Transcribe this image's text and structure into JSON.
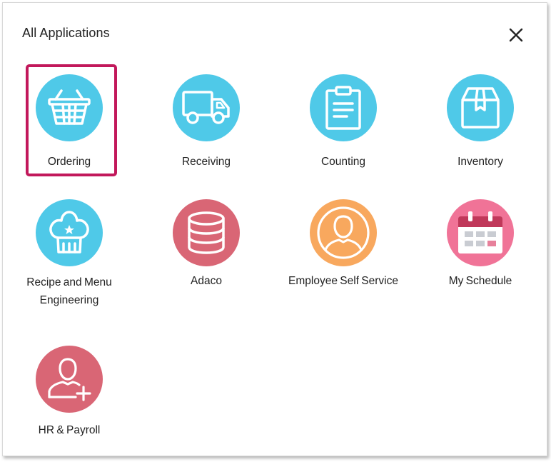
{
  "dialog": {
    "title": "All Applications",
    "close_icon": "close-icon"
  },
  "colors": {
    "blue": "#4fc9e8",
    "red": "#d96675",
    "orange": "#f8a85e",
    "pink": "#f07397",
    "selected_border": "#c2185b"
  },
  "apps": [
    {
      "label": "Ordering",
      "icon": "basket-icon",
      "selected": true
    },
    {
      "label": "Receiving",
      "icon": "truck-icon"
    },
    {
      "label": "Counting",
      "icon": "clipboard-icon"
    },
    {
      "label": "Inventory",
      "icon": "box-icon"
    },
    {
      "label": "Recipe and Menu Engineering",
      "icon": "chef-hat-icon"
    },
    {
      "label": "Adaco",
      "icon": "coin-stack-icon"
    },
    {
      "label": "Employee Self Service",
      "icon": "person-icon"
    },
    {
      "label": "My Schedule",
      "icon": "calendar-icon"
    },
    {
      "label": "HR & Payroll",
      "icon": "add-user-icon"
    }
  ]
}
